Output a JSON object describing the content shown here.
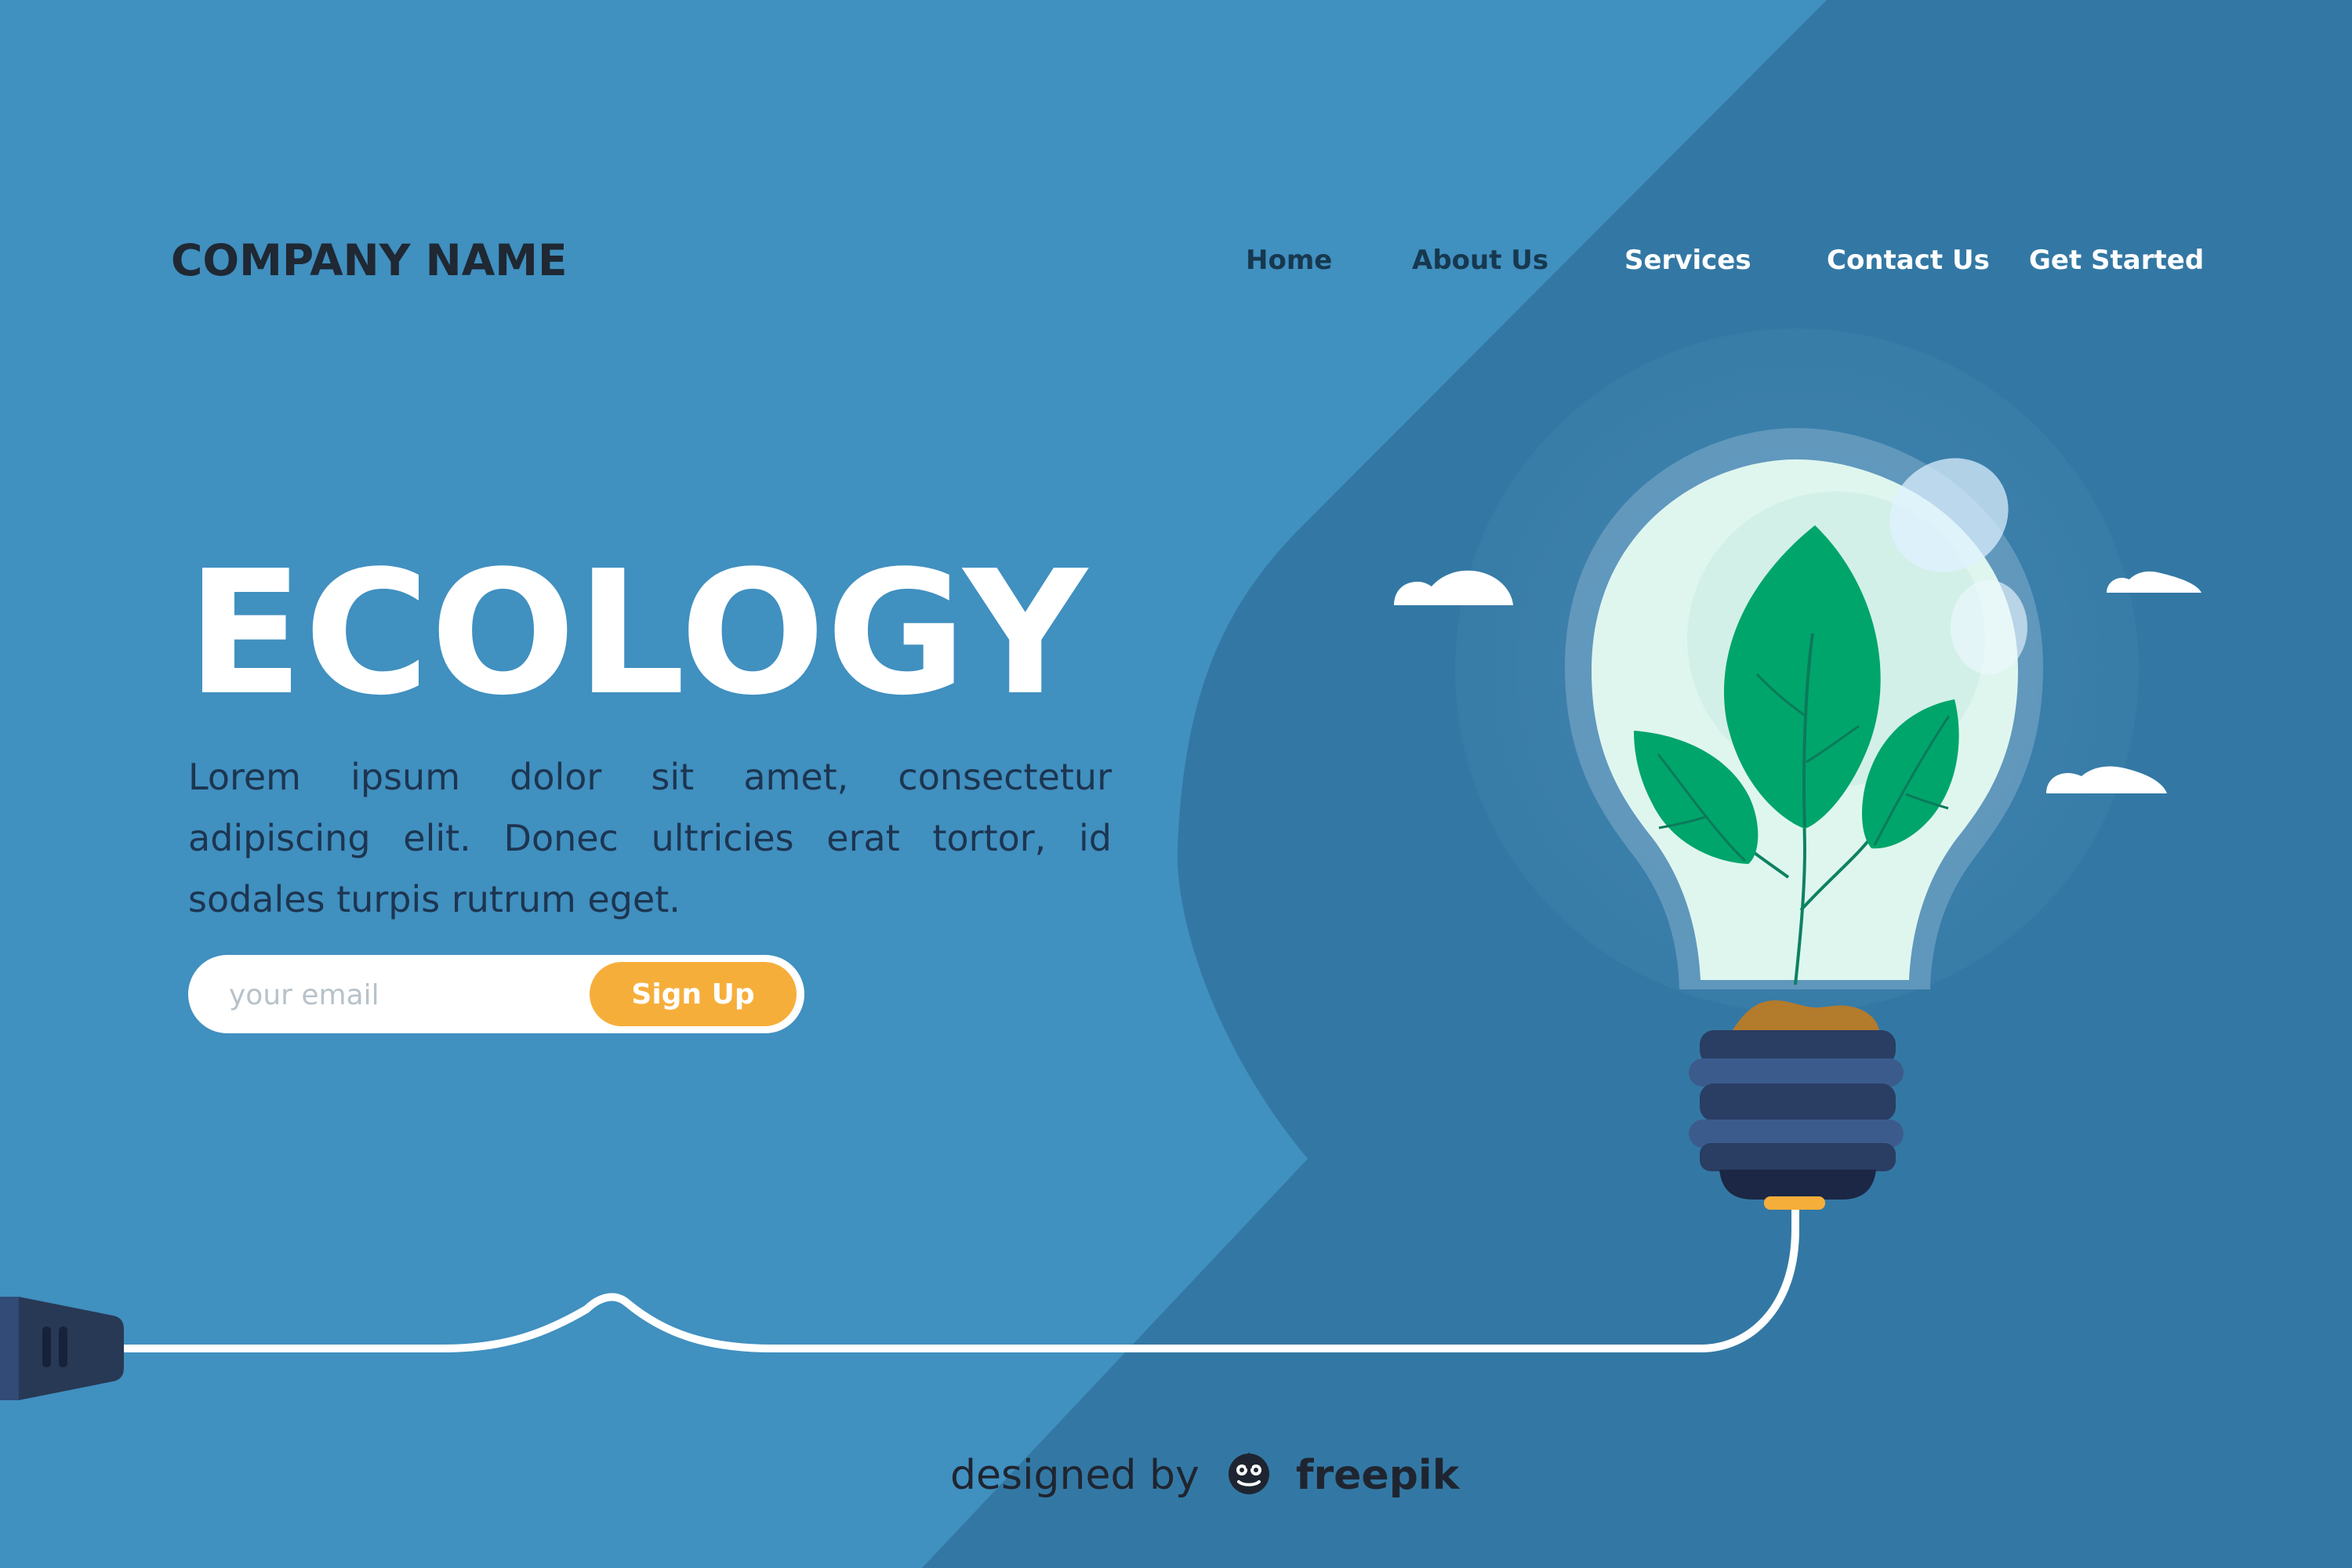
{
  "company": {
    "name": "COMPANY NAME"
  },
  "nav": {
    "home": "Home",
    "about": "About Us",
    "services": "Services",
    "contact": "Contact Us",
    "started": "Get Started"
  },
  "hero": {
    "title": "ECOLOGY",
    "body": "Lorem ipsum dolor sit amet, consectetur adipiscing elit. Donec ultricies erat tortor, id sodales turpis rutrum eget."
  },
  "signup": {
    "placeholder": "your email",
    "button": "Sign Up"
  },
  "credit": {
    "prefix": "designed by",
    "brand": "freepik"
  },
  "icons": {
    "plug": "plug-icon",
    "bulb": "lightbulb-icon",
    "cloud": "cloud-icon",
    "freepik": "freepik-logo-icon"
  },
  "colors": {
    "background": "#4090c0",
    "panel": "#3378a4",
    "accent": "#f6ae3b",
    "brand_text": "#1f2833",
    "body_text": "#1d3550",
    "leaf": "#00a56b"
  }
}
